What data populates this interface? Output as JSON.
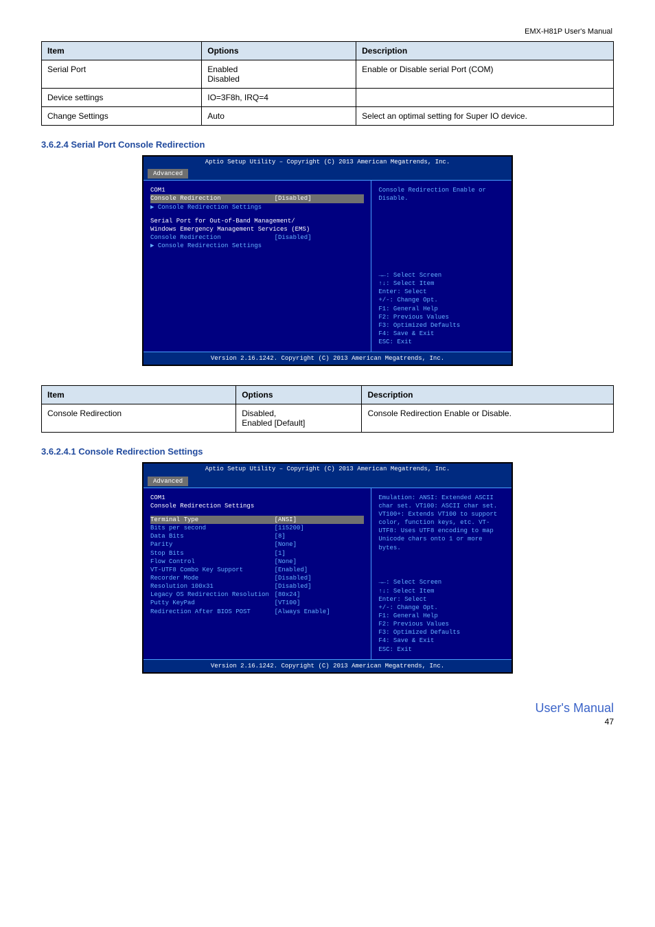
{
  "header_right": "EMX-H81P User's Manual",
  "table1": {
    "headers": [
      "Item",
      "Options",
      "Description"
    ],
    "rows": [
      [
        "Serial Port",
        "Enabled\nDisabled",
        "Enable or Disable serial Port (COM)"
      ],
      [
        "Device settings",
        "IO=3F8h, IRQ=4",
        ""
      ],
      [
        "Change Settings",
        "Auto",
        "Select an optimal setting for Super IO device."
      ]
    ]
  },
  "section1": "3.6.2.4 Serial Port Console Redirection",
  "bios1": {
    "title": "Aptio Setup Utility – Copyright (C) 2013 American Megatrends, Inc.",
    "tab": "Advanced",
    "left": {
      "g1": "COM1",
      "cr_label": "Console Redirection",
      "cr_value": "[Disabled]",
      "crs1": "Console Redirection Settings",
      "g2a": "Serial Port for Out-of-Band Management/",
      "g2b": "Windows Emergency Management Services (EMS)",
      "cr2_label": "Console Redirection",
      "cr2_value": "[Disabled]",
      "crs2": "Console Redirection Settings"
    },
    "help": "Console Redirection Enable or Disable.",
    "hints": [
      "→←: Select Screen",
      "↑↓: Select Item",
      "Enter: Select",
      "+/-: Change Opt.",
      "F1: General Help",
      "F2: Previous Values",
      "F3: Optimized Defaults",
      "F4: Save & Exit",
      "ESC: Exit"
    ],
    "footer": "Version 2.16.1242. Copyright (C) 2013 American Megatrends, Inc."
  },
  "table2": {
    "headers": [
      "Item",
      "Options",
      "Description"
    ],
    "rows": [
      [
        "Console Redirection",
        "Disabled,\nEnabled [Default]",
        "Console Redirection Enable or Disable."
      ]
    ]
  },
  "section2": "3.6.2.4.1 Console Redirection Settings",
  "bios2": {
    "title": "Aptio Setup Utility – Copyright (C) 2013 American Megatrends, Inc.",
    "tab": "Advanced",
    "g1": "COM1",
    "sub": "Console Redirection Settings",
    "rows": [
      {
        "label": "Terminal Type",
        "value": "[ANSI]"
      },
      {
        "label": "Bits per second",
        "value": "[115200]"
      },
      {
        "label": "Data Bits",
        "value": "[8]"
      },
      {
        "label": "Parity",
        "value": "[None]"
      },
      {
        "label": "Stop Bits",
        "value": "[1]"
      },
      {
        "label": "Flow Control",
        "value": "[None]"
      },
      {
        "label": "VT-UTF8 Combo Key Support",
        "value": "[Enabled]"
      },
      {
        "label": "Recorder Mode",
        "value": "[Disabled]"
      },
      {
        "label": "Resolution 100x31",
        "value": "[Disabled]"
      },
      {
        "label": "Legacy OS Redirection Resolution",
        "value": "[80x24]"
      },
      {
        "label": "Putty KeyPad",
        "value": "[VT100]"
      },
      {
        "label": "Redirection After BIOS POST",
        "value": "[Always Enable]"
      }
    ],
    "help": "Emulation: ANSI: Extended ASCII char set. VT100: ASCII char set. VT100+: Extends VT100 to support color, function keys, etc. VT-UTF8: Uses UTF8 encoding to map Unicode chars onto 1 or more bytes.",
    "hints": [
      "→←: Select Screen",
      "↑↓: Select Item",
      "Enter: Select",
      "+/-: Change Opt.",
      "F1: General Help",
      "F2: Previous Values",
      "F3: Optimized Defaults",
      "F4: Save & Exit",
      "ESC: Exit"
    ],
    "footer": "Version 2.16.1242. Copyright (C) 2013 American Megatrends, Inc."
  },
  "footer_label": "User's Manual",
  "footer_page": "47"
}
